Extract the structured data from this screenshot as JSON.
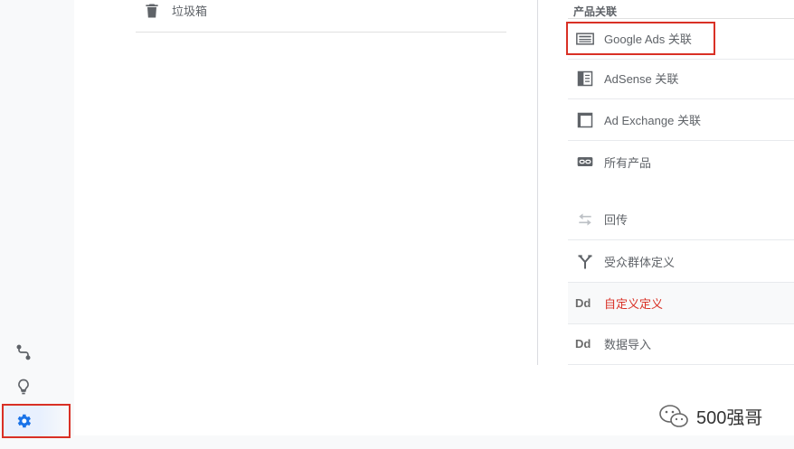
{
  "trash": {
    "label": "垃圾箱"
  },
  "products": {
    "title": "产品关联",
    "items": [
      {
        "label": "Google Ads 关联",
        "icon": "google-ads-icon"
      },
      {
        "label": "AdSense 关联",
        "icon": "adsense-icon"
      },
      {
        "label": "Ad Exchange 关联",
        "icon": "ad-exchange-icon"
      },
      {
        "label": "所有产品",
        "icon": "link-icon"
      }
    ]
  },
  "others": {
    "items": [
      {
        "label": "回传",
        "icon": "postback-icon"
      },
      {
        "label": "受众群体定义",
        "icon": "fork-icon"
      },
      {
        "label": "自定义定义",
        "icon": "dd-icon",
        "glyph": "Dd",
        "active": true
      },
      {
        "label": "数据导入",
        "icon": "dd-icon",
        "glyph": "Dd"
      }
    ]
  },
  "leftnav": {
    "items": [
      {
        "icon": "route-icon"
      },
      {
        "icon": "lightbulb-icon"
      },
      {
        "icon": "gear-icon",
        "selected": true
      }
    ]
  },
  "watermark": {
    "text": "500强哥",
    "icon": "wechat-icon"
  },
  "colors": {
    "accent_red": "#d93025",
    "active_blue": "#1a73e8",
    "text_gray": "#5f6368"
  }
}
